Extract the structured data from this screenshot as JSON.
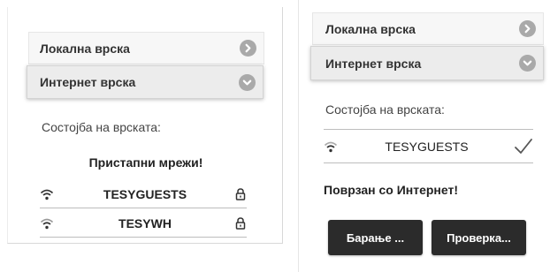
{
  "left": {
    "local_header": "Локална врска",
    "internet_header": "Интернет врска",
    "status_label": "Состојба на врската:",
    "available_title": "Пристапни мрежи!",
    "networks": [
      {
        "name": "TESYGUESTS",
        "icon": "lock-icon"
      },
      {
        "name": "TESYWH",
        "icon": "lock-icon"
      }
    ]
  },
  "right": {
    "local_header": "Локална врска",
    "internet_header": "Интернет врска",
    "status_label": "Состојба на врската:",
    "connected_network": {
      "name": "TESYGUESTS",
      "icon": "checkmark-icon"
    },
    "connected_message": "Поврзан со Интернет!",
    "search_button": "Барање ...",
    "check_button": "Проверка..."
  },
  "colors": {
    "chevron": "#a9a9a9",
    "button_bg": "#2b2b2b",
    "header_expanded_bg": "#ececec",
    "header_collapsed_bg": "#f7f7f7"
  }
}
